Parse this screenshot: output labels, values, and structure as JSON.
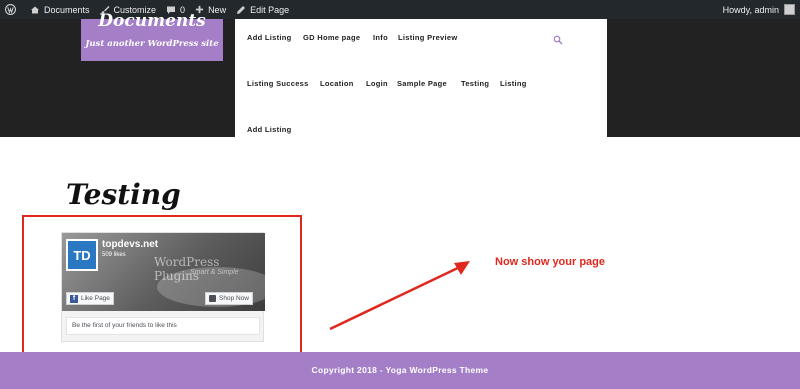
{
  "adminbar": {
    "site_name": "Documents",
    "customize": "Customize",
    "comments_count": "0",
    "new_label": "New",
    "edit_page": "Edit Page",
    "greeting": "Howdy, admin"
  },
  "site": {
    "title": "Documents",
    "tagline": "Just another WordPress site"
  },
  "nav": {
    "items": [
      "Add Listing",
      "GD Home page",
      "Info",
      "Listing Preview",
      "Listing Success",
      "Location",
      "Login",
      "Sample Page",
      "Testing",
      "Listing",
      "Add Listing"
    ]
  },
  "page": {
    "title": "Testing"
  },
  "fb_widget": {
    "avatar_initials": "TD",
    "page_name": "topdevs.net",
    "likes": "509 likes",
    "cover_line1": "WordPress Plugins",
    "cover_line2": "Smart & Simple",
    "like_button": "Like Page",
    "shop_button": "Shop Now",
    "friends_text": "Be the first of your friends to like this"
  },
  "annotation": {
    "text": "Now show your page",
    "color": "#e0281e"
  },
  "footer": {
    "text": "Copyright 2018 - Yoga WordPress Theme"
  },
  "colors": {
    "accent": "#a47fc8",
    "adminbar": "#23282d",
    "header_bg": "#222222"
  }
}
